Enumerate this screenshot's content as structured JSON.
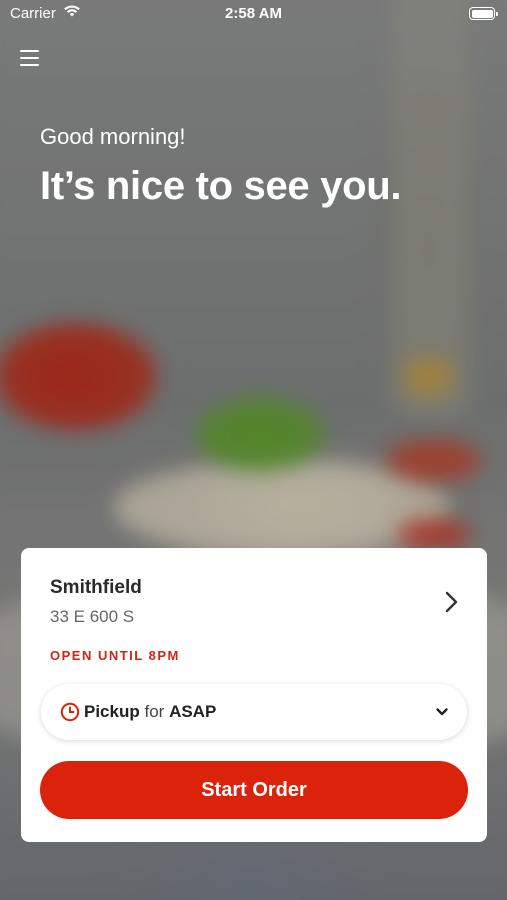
{
  "status_bar": {
    "carrier": "Carrier",
    "time": "2:58 AM"
  },
  "header": {
    "menu_icon": "hamburger-menu-icon"
  },
  "greeting": {
    "line1": "Good morning!",
    "line2": "It’s nice to see you."
  },
  "store_card": {
    "name": "Smithfield",
    "address": "33 E 600 S",
    "hours": "OPEN UNTIL 8PM",
    "order_mode": {
      "method": "Pickup",
      "connector": "for",
      "time": "ASAP"
    },
    "start_button_label": "Start Order"
  },
  "colors": {
    "accent": "#db230c",
    "hours_text": "#d22512",
    "card_bg": "#ffffff"
  },
  "icons": {
    "store_chevron": "chevron-right-icon",
    "clock": "clock-icon",
    "dropdown": "chevron-down-icon",
    "wifi": "wifi-icon",
    "battery": "battery-icon"
  }
}
